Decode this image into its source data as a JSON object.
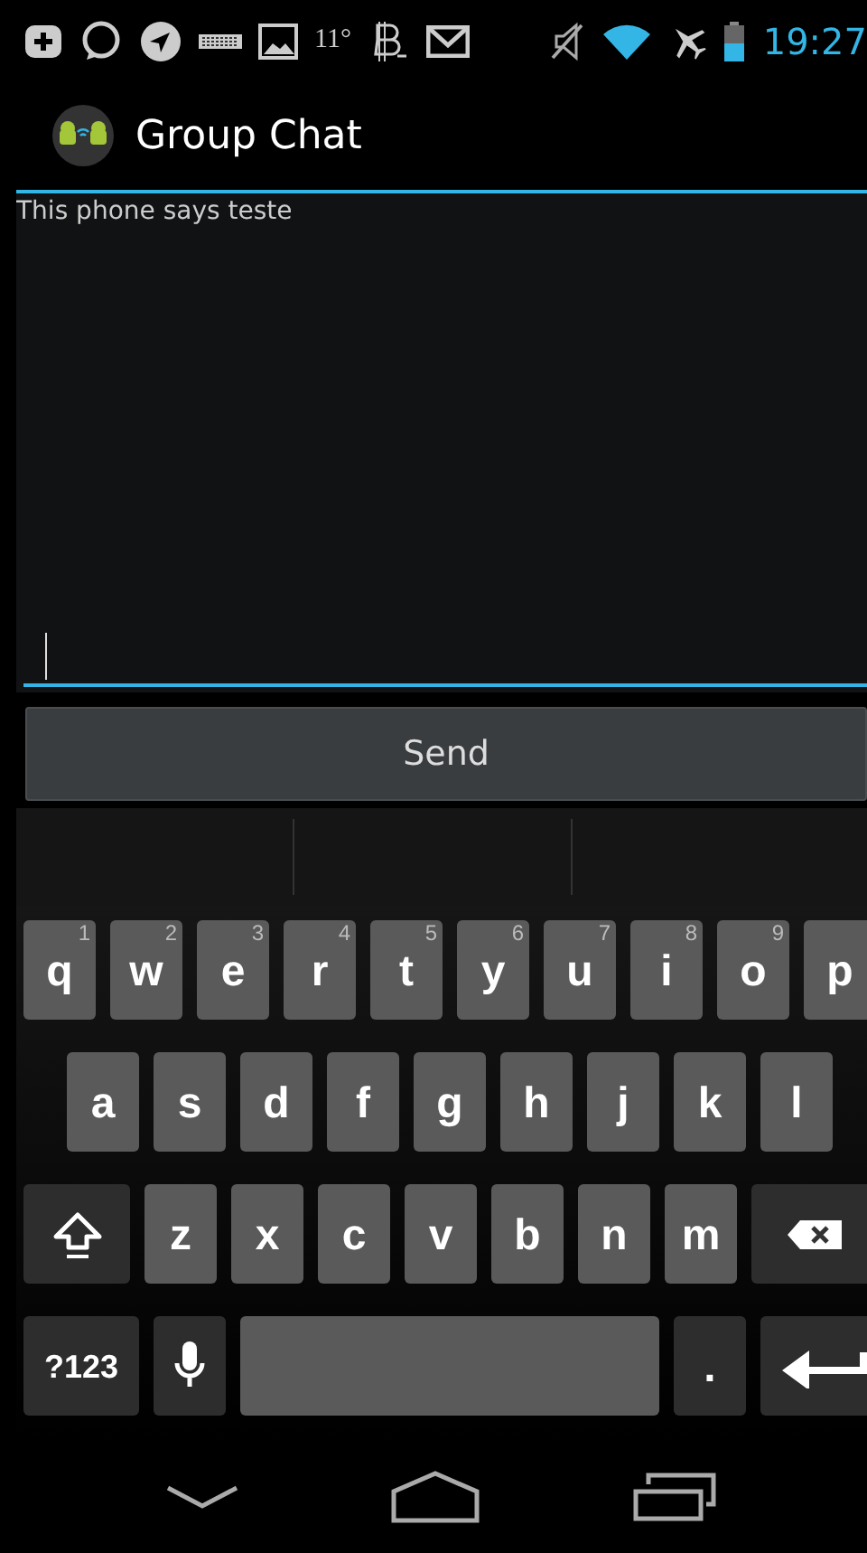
{
  "status_bar": {
    "temperature": "11°",
    "time": "19:27"
  },
  "app_bar": {
    "title": "Group Chat"
  },
  "messages": [
    "This phone says teste"
  ],
  "send_button": {
    "label": "Send"
  },
  "keyboard": {
    "rows": [
      {
        "keys": [
          {
            "kind": "letter",
            "label": "q",
            "hint": "1"
          },
          {
            "kind": "letter",
            "label": "w",
            "hint": "2"
          },
          {
            "kind": "letter",
            "label": "e",
            "hint": "3"
          },
          {
            "kind": "letter",
            "label": "r",
            "hint": "4"
          },
          {
            "kind": "letter",
            "label": "t",
            "hint": "5"
          },
          {
            "kind": "letter",
            "label": "y",
            "hint": "6"
          },
          {
            "kind": "letter",
            "label": "u",
            "hint": "7"
          },
          {
            "kind": "letter",
            "label": "i",
            "hint": "8"
          },
          {
            "kind": "letter",
            "label": "o",
            "hint": "9"
          },
          {
            "kind": "letter",
            "label": "p"
          }
        ]
      },
      {
        "keys": [
          {
            "kind": "letter",
            "label": "a"
          },
          {
            "kind": "letter",
            "label": "s"
          },
          {
            "kind": "letter",
            "label": "d"
          },
          {
            "kind": "letter",
            "label": "f"
          },
          {
            "kind": "letter",
            "label": "g"
          },
          {
            "kind": "letter",
            "label": "h"
          },
          {
            "kind": "letter",
            "label": "j"
          },
          {
            "kind": "letter",
            "label": "k"
          },
          {
            "kind": "letter",
            "label": "l"
          }
        ]
      },
      {
        "keys": [
          {
            "kind": "shift"
          },
          {
            "kind": "letter",
            "label": "z"
          },
          {
            "kind": "letter",
            "label": "x"
          },
          {
            "kind": "letter",
            "label": "c"
          },
          {
            "kind": "letter",
            "label": "v"
          },
          {
            "kind": "letter",
            "label": "b"
          },
          {
            "kind": "letter",
            "label": "n"
          },
          {
            "kind": "letter",
            "label": "m"
          },
          {
            "kind": "delete"
          }
        ]
      },
      {
        "keys": [
          {
            "kind": "symbols",
            "label": "?123"
          },
          {
            "kind": "mic"
          },
          {
            "kind": "space"
          },
          {
            "kind": "period",
            "label": "."
          },
          {
            "kind": "enter"
          }
        ]
      }
    ]
  }
}
